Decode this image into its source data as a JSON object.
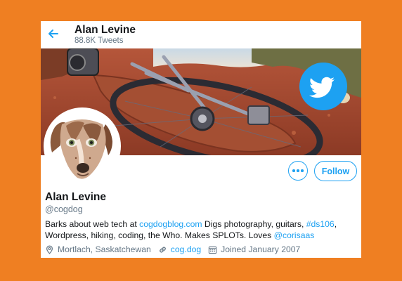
{
  "header": {
    "name": "Alan Levine",
    "tweet_count": "88.8K Tweets"
  },
  "profile": {
    "name": "Alan Levine",
    "handle": "@cogdog",
    "bio": {
      "t1": "Barks about web tech at ",
      "link1": "cogdogblog.com",
      "t2": " Digs photography, guitars, ",
      "hashtag": "#ds106",
      "t3": ", Wordpress, hiking, coding, the Who. Makes SPLOTs. Loves ",
      "mention": "@corisaas"
    },
    "location": "Mortlach, Saskatchewan",
    "website": "cog.dog",
    "joined": "Joined January 2007"
  },
  "buttons": {
    "follow_label": "Follow"
  },
  "icons": {
    "back": "arrow-left-icon",
    "more": "more-icon",
    "location": "location-pin-icon",
    "link": "link-icon",
    "calendar": "calendar-icon",
    "twitter": "twitter-bird-icon"
  },
  "colors": {
    "background": "#ef7f22",
    "accent": "#1da1f2",
    "text": "#14171a",
    "muted": "#657786"
  }
}
